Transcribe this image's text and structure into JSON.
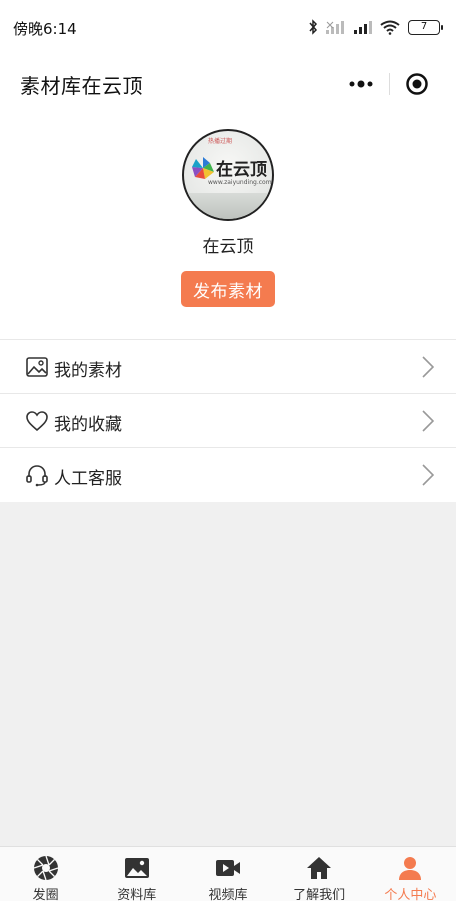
{
  "status_bar": {
    "time": "傍晚6:14",
    "battery": "7"
  },
  "nav": {
    "title": "素材库在云顶"
  },
  "profile": {
    "name": "在云顶",
    "avatar_brand": "在云顶",
    "avatar_url": "www.zaiyunding.com",
    "avatar_top_text": "热播过期",
    "publish_label": "发布素材"
  },
  "menu": [
    {
      "label": "我的素材",
      "icon": "image-icon"
    },
    {
      "label": "我的收藏",
      "icon": "heart-icon"
    },
    {
      "label": "人工客服",
      "icon": "headset-icon"
    }
  ],
  "tabs": [
    {
      "label": "发圈",
      "icon": "aperture-icon",
      "active": false
    },
    {
      "label": "资料库",
      "icon": "image-icon",
      "active": false
    },
    {
      "label": "视频库",
      "icon": "video-icon",
      "active": false
    },
    {
      "label": "了解我们",
      "icon": "home-icon",
      "active": false
    },
    {
      "label": "个人中心",
      "icon": "user-icon",
      "active": true
    }
  ],
  "colors": {
    "accent": "#f47b4f",
    "background": "#f0f0f0",
    "tab_inactive": "#333333"
  }
}
